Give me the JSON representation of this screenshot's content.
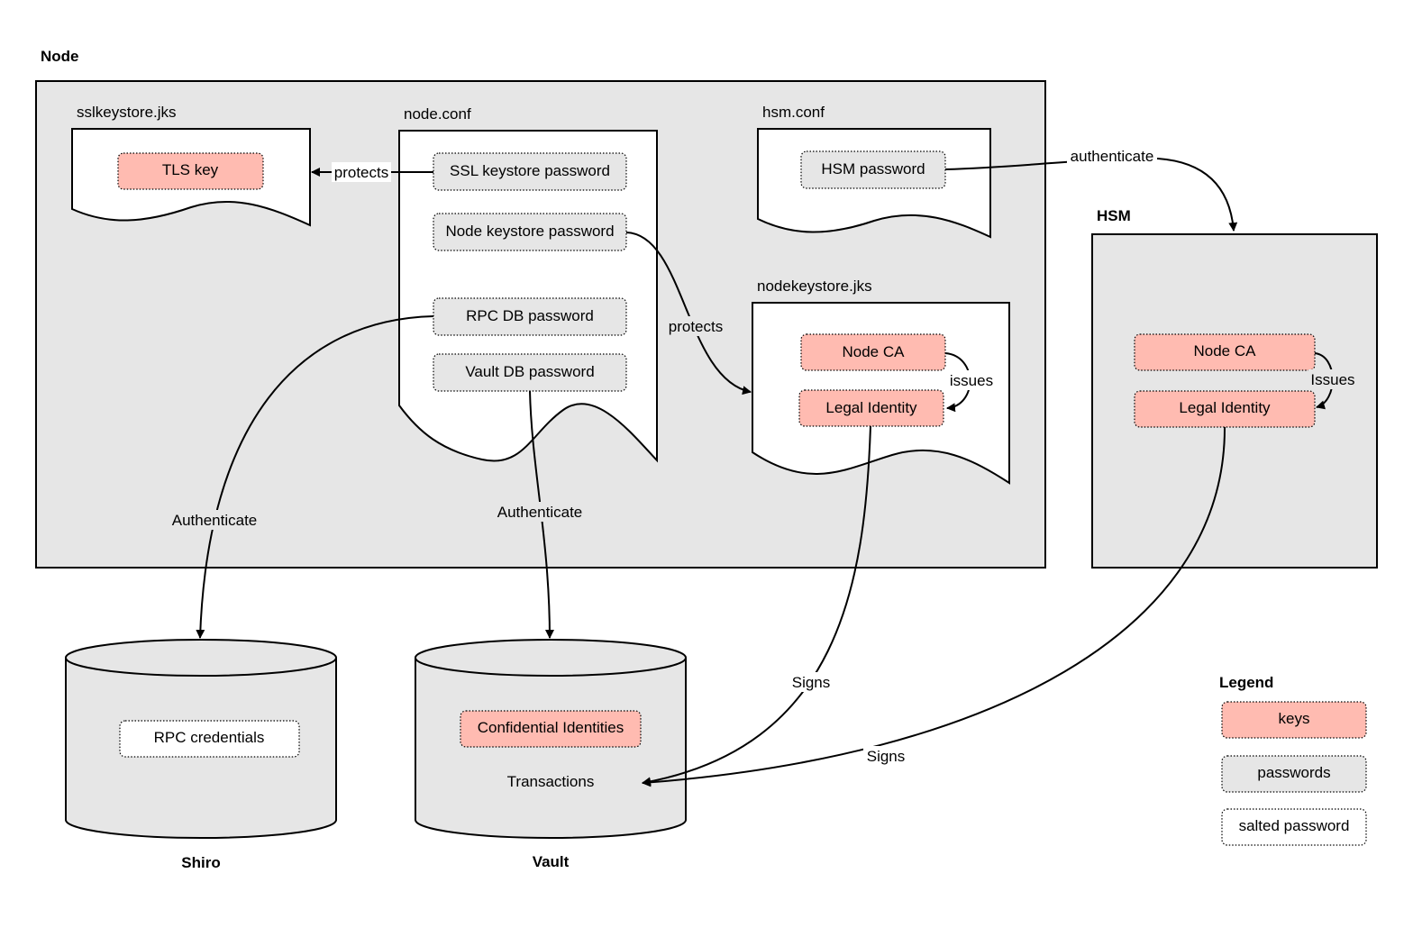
{
  "colors": {
    "key": "#ffbbb1",
    "password": "#e6e6e6",
    "container": "#e6e6e6"
  },
  "node": {
    "title": "Node"
  },
  "sslkeystore": {
    "title": "sslkeystore.jks",
    "tls_key": "TLS key"
  },
  "nodeconf": {
    "title": "node.conf",
    "ssl_pw": "SSL keystore password",
    "node_pw": "Node keystore password",
    "rpc_pw": "RPC DB password",
    "vault_pw": "Vault DB password"
  },
  "hsmconf": {
    "title": "hsm.conf",
    "hsm_pw": "HSM password"
  },
  "nodekeystore": {
    "title": "nodekeystore.jks",
    "node_ca": "Node CA",
    "legal_identity": "Legal Identity"
  },
  "hsm": {
    "title": "HSM",
    "node_ca": "Node CA",
    "legal_identity": "Legal Identity"
  },
  "shiro": {
    "title": "Shiro",
    "rpc_credentials": "RPC credentials"
  },
  "vault": {
    "title": "Vault",
    "confidential": "Confidential Identities",
    "transactions": "Transactions"
  },
  "edges": {
    "protects1": "protects",
    "protects2": "protects",
    "authenticate_hsm": "authenticate",
    "authenticate_rpc": "Authenticate",
    "authenticate_vault": "Authenticate",
    "issues1": "issues",
    "issues2": "Issues",
    "signs1": "Signs",
    "signs2": "Signs"
  },
  "legend": {
    "title": "Legend",
    "keys": "keys",
    "passwords": "passwords",
    "salted": "salted password"
  }
}
